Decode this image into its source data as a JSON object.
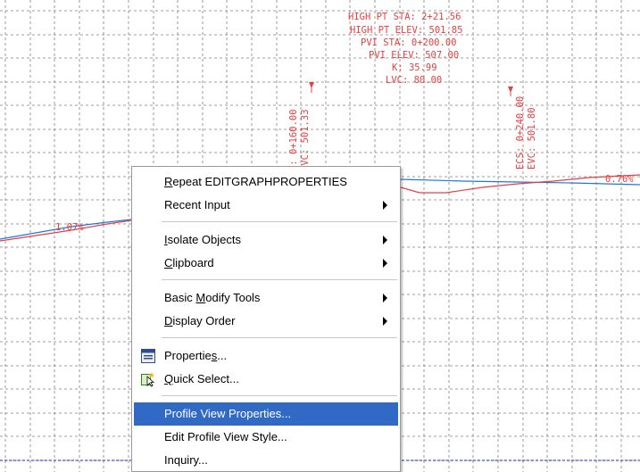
{
  "drawing": {
    "high_point_labels": [
      "HIGH PT STA:  2+21.56",
      "HIGH PT ELEV: 501.85",
      "PVI STA: 0+200.00",
      "PVI ELEV: 507.00",
      "K: 35.99",
      "LVC: 80.00"
    ],
    "bvc_labels": [
      "S: 0+160.00",
      "BVC: 501.33"
    ],
    "evc_labels": [
      "ECS: 0+240.00",
      "EVC: 501.80"
    ],
    "grade_left": "1.07%",
    "grade_right": "0.76%"
  },
  "context_menu": {
    "items": [
      {
        "label": "Repeat EDITGRAPHPROPERTIES",
        "mnemonic": "R",
        "submenu": false,
        "icon": null
      },
      {
        "label": "Recent Input",
        "mnemonic": "",
        "submenu": true,
        "icon": null
      },
      {
        "label": "Isolate Objects",
        "mnemonic": "I",
        "submenu": true,
        "icon": null
      },
      {
        "label": "Clipboard",
        "mnemonic": "C",
        "submenu": true,
        "icon": null
      },
      {
        "label": "Basic Modify Tools",
        "mnemonic": "M",
        "submenu": true,
        "icon": null
      },
      {
        "label": "Display Order",
        "mnemonic": "D",
        "submenu": true,
        "icon": null
      },
      {
        "label": "Properties...",
        "mnemonic": "s",
        "submenu": false,
        "icon": "properties-icon"
      },
      {
        "label": "Quick Select...",
        "mnemonic": "Q",
        "submenu": false,
        "icon": "quick-select-icon"
      },
      {
        "label": "Profile View Properties...",
        "mnemonic": "",
        "submenu": false,
        "icon": null,
        "highlighted": true
      },
      {
        "label": "Edit Profile View Style...",
        "mnemonic": "",
        "submenu": false,
        "icon": null
      },
      {
        "label": "Inquiry...",
        "mnemonic": "",
        "submenu": false,
        "icon": null
      }
    ]
  },
  "colors": {
    "grid": "#808080",
    "profile_red": "#e84040",
    "profile_blue": "#1e78dc",
    "highlight": "#316ac5",
    "dashed_blue": "#2020c0"
  }
}
